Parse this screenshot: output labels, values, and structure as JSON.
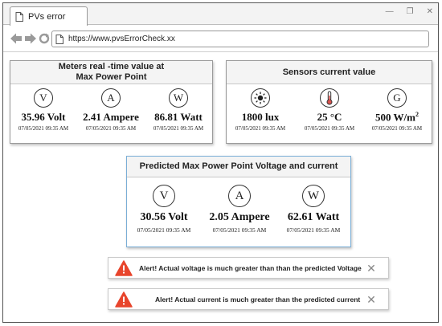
{
  "window": {
    "tab_title": "PVs error",
    "address": "https://www.pvsErrorCheck.xx"
  },
  "meters_panel": {
    "title_line1": "Meters real -time value at",
    "title_line2": "Max Power Point",
    "items": [
      {
        "symbol": "V",
        "value": "35.96 Volt",
        "time": "07/05/2021 09:35 AM"
      },
      {
        "symbol": "A",
        "value": "2.41 Ampere",
        "time": "07/05/2021 09:35 AM"
      },
      {
        "symbol": "W",
        "value": "86.81 Watt",
        "time": "07/05/2021 09:35 AM"
      }
    ]
  },
  "sensors_panel": {
    "title": "Sensors current value",
    "items": [
      {
        "icon": "sun-icon",
        "value": "1800 lux",
        "time": "07/05/2021 09:35 AM"
      },
      {
        "icon": "thermometer-icon",
        "value": "25 °C",
        "time": "07/05/2021 09:35 AM"
      },
      {
        "symbol": "G",
        "value": "500 W/m",
        "value_sup": "2",
        "time": "07/05/2021 09:35 AM"
      }
    ]
  },
  "predicted_panel": {
    "title": "Predicted Max Power Point Voltage and current",
    "items": [
      {
        "symbol": "V",
        "value": "30.56 Volt",
        "time": "07/05/2021 09:35 AM"
      },
      {
        "symbol": "A",
        "value": "2.05 Ampere",
        "time": "07/05/2021 09:35 AM"
      },
      {
        "symbol": "W",
        "value": "62.61 Watt",
        "time": "07/05/2021 09:35 AM"
      }
    ]
  },
  "alerts": [
    {
      "message": "Alert! Actual voltage is much greater than than the predicted Voltage"
    },
    {
      "message": "Alert! Actual current is much greater than the predicted current"
    }
  ],
  "colors": {
    "alert_red": "#e8452c",
    "panel_blue_border": "#7aaed6"
  }
}
